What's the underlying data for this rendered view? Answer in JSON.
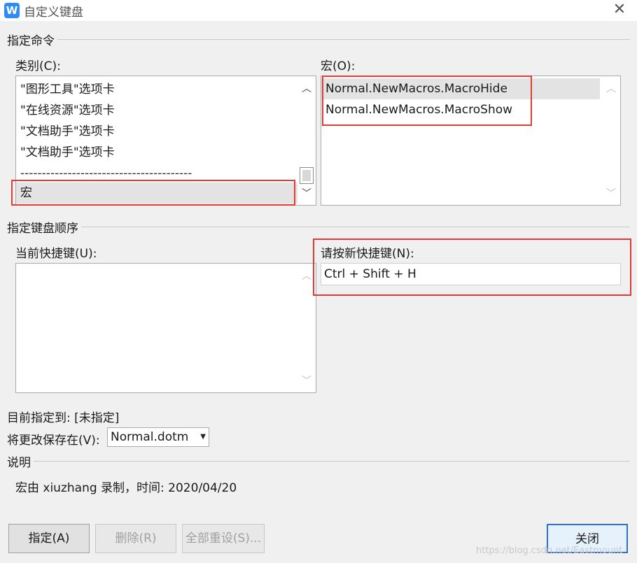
{
  "window": {
    "title": "自定义键盘",
    "app_icon_letter": "W"
  },
  "command_section": {
    "label": "指定命令",
    "category": {
      "label": "类别(C):",
      "items": [
        "\"图形工具\"选项卡",
        "\"在线资源\"选项卡",
        "\"文档助手\"选项卡",
        "\"文档助手\"选项卡",
        "----------------------------------------",
        "宏"
      ],
      "selected": "宏"
    },
    "macro": {
      "label": "宏(O):",
      "items": [
        "Normal.NewMacros.MacroHide",
        "Normal.NewMacros.MacroShow"
      ],
      "selected": "Normal.NewMacros.MacroHide"
    }
  },
  "keyboard_section": {
    "label": "指定键盘顺序",
    "current_keys_label": "当前快捷键(U):",
    "new_key_label": "请按新快捷键(N):",
    "new_key_value": "Ctrl + Shift + H"
  },
  "assigned_to": "目前指定到: [未指定]",
  "save_in": {
    "label": "将更改保存在(V):",
    "value": "Normal.dotm"
  },
  "description_section": {
    "label": "说明",
    "text": "宏由 xiuzhang 录制，时间: 2020/04/20"
  },
  "buttons": {
    "assign": "指定(A)",
    "delete": "删除(R)",
    "reset_all": "全部重设(S)...",
    "close": "关闭"
  },
  "watermark": "https://blog.csdn.net/Eastmount",
  "colors": {
    "highlight_red": "#e53935",
    "app_blue": "#2f8cf4"
  }
}
